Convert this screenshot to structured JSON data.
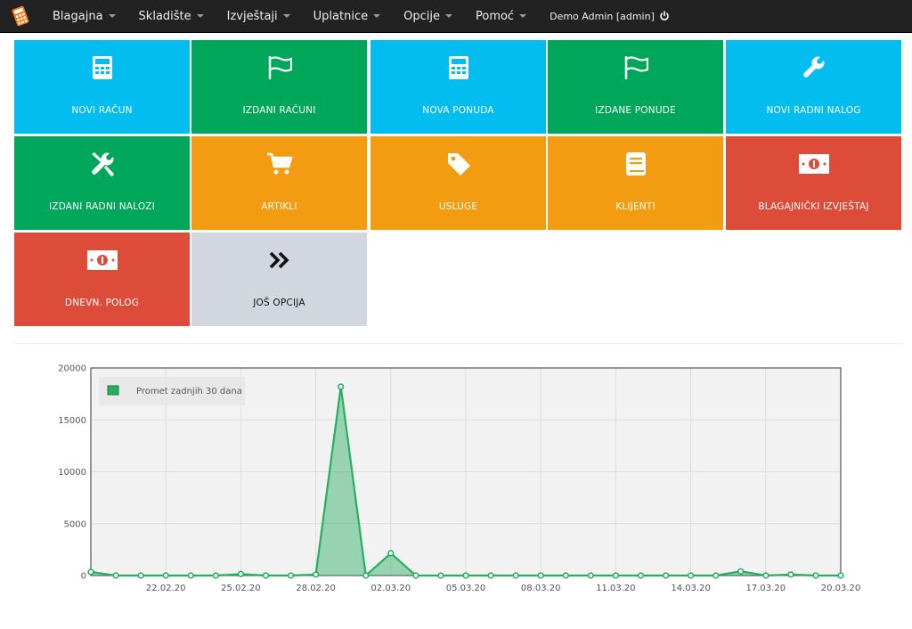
{
  "navbar": {
    "menu": [
      {
        "label": "Blagajna"
      },
      {
        "label": "Skladište"
      },
      {
        "label": "Izvještaji"
      },
      {
        "label": "Uplatnice"
      },
      {
        "label": "Opcije"
      },
      {
        "label": "Pomoć"
      }
    ],
    "user": "Demo Admin [admin]"
  },
  "tiles": [
    {
      "label": "NOVI RAČUN",
      "icon": "calculator-icon",
      "color": "#03bdf0"
    },
    {
      "label": "IZDANI RAČUNI",
      "icon": "flag-icon",
      "color": "#00a65a"
    },
    {
      "label": "NOVA PONUDA",
      "icon": "calculator-icon",
      "color": "#03bdf0"
    },
    {
      "label": "IZDANE PONUDE",
      "icon": "flag-icon",
      "color": "#00a65a"
    },
    {
      "label": "NOVI RADNI NALOG",
      "icon": "wrench-icon",
      "color": "#03bdf0"
    },
    {
      "label": "IZDANI RADNI NALOZI",
      "icon": "tools-icon",
      "color": "#00a65a"
    },
    {
      "label": "ARTIKLI",
      "icon": "cart-icon",
      "color": "#f39c12"
    },
    {
      "label": "USLUGE",
      "icon": "tag-icon",
      "color": "#f39c12"
    },
    {
      "label": "KLIJENTI",
      "icon": "book-icon",
      "color": "#f39c12"
    },
    {
      "label": "BLAGAJNIČKI IZVJEŠTAJ",
      "icon": "money-icon",
      "color": "#dd4b39"
    },
    {
      "label": "DNEVN. POLOG",
      "icon": "money-icon",
      "color": "#dd4b39"
    },
    {
      "label": "JOŠ OPCIJA",
      "icon": "double-chevron-right-icon",
      "color": "#d2d6de"
    }
  ],
  "chart_data": {
    "type": "area",
    "series": [
      {
        "name": "Promet zadnjih 30 dana",
        "color": "#27ae60",
        "values": [
          350,
          0,
          0,
          0,
          0,
          0,
          150,
          0,
          0,
          100,
          18200,
          0,
          2150,
          0,
          0,
          0,
          0,
          0,
          0,
          0,
          0,
          0,
          0,
          0,
          0,
          0,
          400,
          0,
          100,
          0,
          0
        ]
      }
    ],
    "x": [
      "19.02.20",
      "20.02.20",
      "21.02.20",
      "22.02.20",
      "23.02.20",
      "24.02.20",
      "25.02.20",
      "26.02.20",
      "27.02.20",
      "28.02.20",
      "29.02.20",
      "01.03.20",
      "02.03.20",
      "03.03.20",
      "04.03.20",
      "05.03.20",
      "06.03.20",
      "07.03.20",
      "08.03.20",
      "09.03.20",
      "10.03.20",
      "11.03.20",
      "12.03.20",
      "13.03.20",
      "14.03.20",
      "15.03.20",
      "16.03.20",
      "17.03.20",
      "18.03.20",
      "19.03.20",
      "20.03.20"
    ],
    "x_ticks": [
      "22.02.20",
      "25.02.20",
      "28.02.20",
      "02.03.20",
      "05.03.20",
      "08.03.20",
      "11.03.20",
      "14.03.20",
      "17.03.20",
      "20.03.20"
    ],
    "y_ticks": [
      0,
      5000,
      10000,
      15000,
      20000
    ],
    "ylim": [
      0,
      20000
    ],
    "grid": true,
    "legend": "top-left"
  }
}
